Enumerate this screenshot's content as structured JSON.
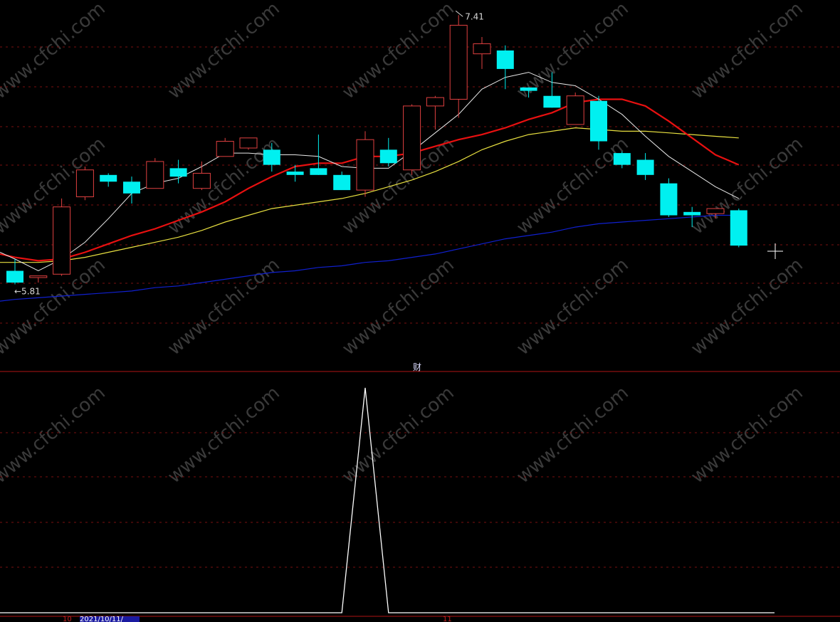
{
  "chart_data": {
    "type": "candlestick",
    "price_range": [
      5.3,
      7.5
    ],
    "high_label": "7.41",
    "low_label": "5.81",
    "panel_label": "财",
    "date_label": "2021/10/11/",
    "month_ticks": [
      "10",
      "11"
    ],
    "candles": [
      {
        "o": 5.89,
        "h": 5.96,
        "l": 5.81,
        "c": 5.82,
        "dir": "down"
      },
      {
        "o": 5.85,
        "h": 5.86,
        "l": 5.82,
        "c": 5.86,
        "dir": "up"
      },
      {
        "o": 5.87,
        "h": 6.32,
        "l": 5.86,
        "c": 6.27,
        "dir": "up"
      },
      {
        "o": 6.33,
        "h": 6.51,
        "l": 6.31,
        "c": 6.49,
        "dir": "up"
      },
      {
        "o": 6.46,
        "h": 6.47,
        "l": 6.39,
        "c": 6.42,
        "dir": "down"
      },
      {
        "o": 6.42,
        "h": 6.45,
        "l": 6.29,
        "c": 6.35,
        "dir": "down"
      },
      {
        "o": 6.38,
        "h": 6.56,
        "l": 6.38,
        "c": 6.54,
        "dir": "up"
      },
      {
        "o": 6.5,
        "h": 6.55,
        "l": 6.41,
        "c": 6.45,
        "dir": "down"
      },
      {
        "o": 6.38,
        "h": 6.54,
        "l": 6.37,
        "c": 6.47,
        "dir": "up"
      },
      {
        "o": 6.57,
        "h": 6.68,
        "l": 6.57,
        "c": 6.66,
        "dir": "up"
      },
      {
        "o": 6.62,
        "h": 6.68,
        "l": 6.61,
        "c": 6.68,
        "dir": "up"
      },
      {
        "o": 6.61,
        "h": 6.65,
        "l": 6.48,
        "c": 6.52,
        "dir": "down"
      },
      {
        "o": 6.48,
        "h": 6.52,
        "l": 6.42,
        "c": 6.46,
        "dir": "down"
      },
      {
        "o": 6.5,
        "h": 6.7,
        "l": 6.46,
        "c": 6.46,
        "dir": "down"
      },
      {
        "o": 6.46,
        "h": 6.48,
        "l": 6.42,
        "c": 6.37,
        "dir": "down"
      },
      {
        "o": 6.37,
        "h": 6.72,
        "l": 6.33,
        "c": 6.67,
        "dir": "up"
      },
      {
        "o": 6.61,
        "h": 6.68,
        "l": 6.51,
        "c": 6.53,
        "dir": "down"
      },
      {
        "o": 6.49,
        "h": 6.88,
        "l": 6.46,
        "c": 6.87,
        "dir": "up"
      },
      {
        "o": 6.87,
        "h": 6.93,
        "l": 6.73,
        "c": 6.92,
        "dir": "up"
      },
      {
        "o": 6.91,
        "h": 7.41,
        "l": 6.8,
        "c": 7.35,
        "dir": "up"
      },
      {
        "o": 7.18,
        "h": 7.28,
        "l": 7.09,
        "c": 7.24,
        "dir": "up"
      },
      {
        "o": 7.2,
        "h": 7.23,
        "l": 6.97,
        "c": 7.09,
        "dir": "down"
      },
      {
        "o": 6.98,
        "h": 6.98,
        "l": 6.92,
        "c": 6.96,
        "dir": "down"
      },
      {
        "o": 6.93,
        "h": 7.07,
        "l": 6.86,
        "c": 6.86,
        "dir": "down"
      },
      {
        "o": 6.76,
        "h": 6.95,
        "l": 6.76,
        "c": 6.93,
        "dir": "up"
      },
      {
        "o": 6.9,
        "h": 6.93,
        "l": 6.61,
        "c": 6.66,
        "dir": "down"
      },
      {
        "o": 6.59,
        "h": 6.6,
        "l": 6.5,
        "c": 6.52,
        "dir": "down"
      },
      {
        "o": 6.55,
        "h": 6.59,
        "l": 6.43,
        "c": 6.46,
        "dir": "down"
      },
      {
        "o": 6.41,
        "h": 6.44,
        "l": 6.21,
        "c": 6.22,
        "dir": "down"
      },
      {
        "o": 6.24,
        "h": 6.27,
        "l": 6.15,
        "c": 6.22,
        "dir": "down"
      },
      {
        "o": 6.23,
        "h": 6.25,
        "l": 6.2,
        "c": 6.26,
        "dir": "up"
      },
      {
        "o": 6.25,
        "h": 6.26,
        "l": 6.03,
        "c": 6.04,
        "dir": "down"
      }
    ],
    "ma5": [
      6.0,
      5.96,
      5.89,
      5.96,
      6.06,
      6.2,
      6.35,
      6.41,
      6.44,
      6.51,
      6.59,
      6.59,
      6.58,
      6.58,
      6.57,
      6.51,
      6.5,
      6.5,
      6.6,
      6.71,
      6.82,
      6.97,
      7.04,
      7.07,
      7.01,
      6.99,
      6.91,
      6.82,
      6.69,
      6.57,
      6.48,
      6.39,
      6.32
    ],
    "ma10": [
      5.99,
      5.97,
      5.95,
      5.96,
      6.0,
      6.05,
      6.1,
      6.14,
      6.19,
      6.24,
      6.3,
      6.38,
      6.45,
      6.51,
      6.53,
      6.53,
      6.57,
      6.57,
      6.59,
      6.63,
      6.67,
      6.7,
      6.74,
      6.79,
      6.83,
      6.89,
      6.91,
      6.91,
      6.87,
      6.78,
      6.68,
      6.58,
      6.52
    ],
    "ma20": [
      5.94,
      5.94,
      5.94,
      5.95,
      5.97,
      6.0,
      6.03,
      6.06,
      6.09,
      6.13,
      6.18,
      6.22,
      6.26,
      6.28,
      6.3,
      6.32,
      6.35,
      6.39,
      6.43,
      6.48,
      6.54,
      6.61,
      6.66,
      6.7,
      6.72,
      6.74,
      6.73,
      6.72,
      6.72,
      6.71,
      6.7,
      6.69,
      6.68
    ],
    "ma60": [
      5.71,
      5.72,
      5.73,
      5.74,
      5.75,
      5.76,
      5.77,
      5.79,
      5.8,
      5.82,
      5.84,
      5.86,
      5.88,
      5.89,
      5.91,
      5.92,
      5.94,
      5.95,
      5.97,
      5.99,
      6.02,
      6.05,
      6.08,
      6.1,
      6.12,
      6.15,
      6.17,
      6.18,
      6.19,
      6.2,
      6.21,
      6.22,
      6.22
    ],
    "indicator": [
      0,
      0,
      0,
      0,
      0,
      0,
      0,
      0,
      0,
      0,
      0,
      0,
      0,
      0,
      0,
      1,
      0,
      0,
      0,
      0,
      0,
      0,
      0,
      0,
      0,
      0,
      0,
      0,
      0,
      0,
      0,
      0,
      0
    ],
    "colors": {
      "up": "#e04040",
      "down": "#00f0f0",
      "ma5": "#e8e8e8",
      "ma10": "#e81010",
      "ma20": "#e8e040",
      "ma60": "#1020d0",
      "indicator": "#ffffff",
      "grid": "#7a1010",
      "divider": "#b01515"
    }
  },
  "watermark": "www.cfchi.com"
}
